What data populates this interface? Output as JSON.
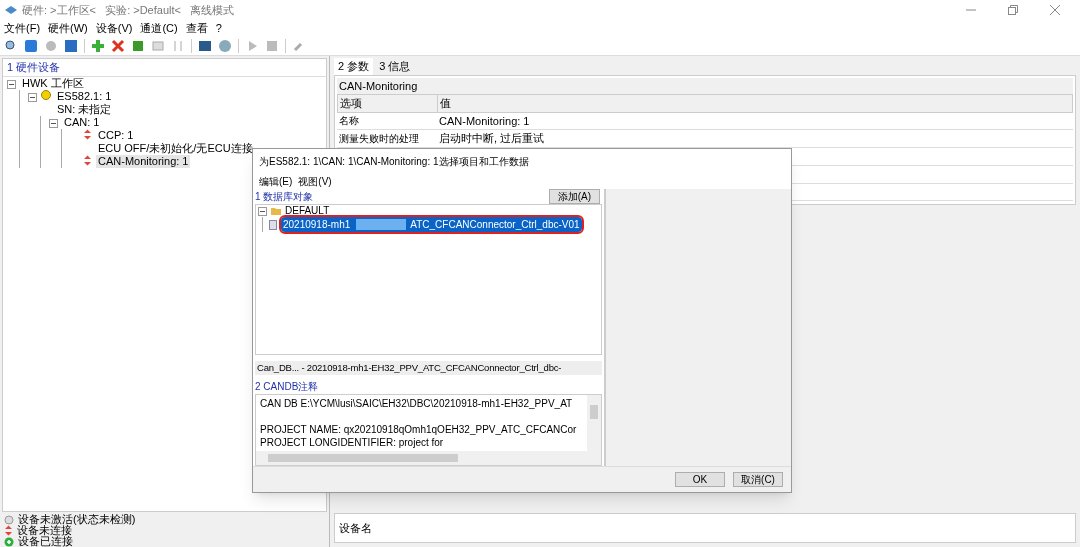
{
  "window": {
    "title": "硬件: >工作区<   实验: >Default<   离线模式"
  },
  "menu": [
    "文件(F)",
    "硬件(W)",
    "设备(V)",
    "通道(C)",
    "查看",
    "?"
  ],
  "hardware_panel": {
    "title": "1 硬件设备",
    "tree": [
      {
        "label": "HWK 工作区",
        "selected": false,
        "children": [
          {
            "label": "ES582.1: 1",
            "sublabel": "SN: 未指定",
            "kind": "unknown",
            "selected": false,
            "children": [
              {
                "label": "CAN: 1",
                "selected": false,
                "children": [
                  {
                    "label": "CCP: 1",
                    "sublabel": "ECU OFF/未初始化/无ECU连接",
                    "kind": "disconnected",
                    "selected": false
                  },
                  {
                    "label": "CAN-Monitoring: 1",
                    "kind": "disconnected",
                    "selected": true
                  }
                ]
              }
            ]
          }
        ]
      }
    ]
  },
  "legend": [
    {
      "label": "设备未激活(状态未检测)",
      "kind": "inactive"
    },
    {
      "label": "设备未连接",
      "kind": "disconnected"
    },
    {
      "label": "设备已连接",
      "kind": "connected"
    }
  ],
  "tabs": [
    {
      "label": "2 参数",
      "selected": true
    },
    {
      "label": "3 信息",
      "selected": false
    }
  ],
  "params": {
    "title": "CAN-Monitoring",
    "columns": [
      "选项",
      "值"
    ],
    "rows": [
      [
        "名称",
        "CAN-Monitoring: 1"
      ],
      [
        "测量失败时的处理",
        "启动时中断, 过后重试"
      ]
    ]
  },
  "device_name_label": "设备名",
  "dialog": {
    "title": "为ES582.1: 1\\CAN: 1\\CAN-Monitoring: 1选择项目和工作数据",
    "menu": [
      "编辑(E)",
      "视图(V)"
    ],
    "db_title": "1 数据库对象",
    "add_button": "添加(A)",
    "db_tree": {
      "label": "DEFAULT",
      "items": [
        {
          "label_start": "20210918-mh1",
          "label_end": "ATC_CFCANConnector_Ctrl_dbc-V01",
          "selected": true
        }
      ]
    },
    "status_line": "Can_DB... - 20210918-mh1-EH32_PPV_ATC_CFCANConnector_Ctrl_dbc-",
    "comment_title": "2 CANDB注释",
    "comment_paragraphs": [
      [
        "CAN DB E:\\YCM\\lusi\\SAIC\\EH32\\DBC\\20210918-mh1-EH32_PPV_AT"
      ],
      [
        "PROJECT NAME: qx20210918qOmh1qOEH32_PPV_ATC_CFCANCor",
        "PROJECT LONGIDENTIFIER: project for"
      ]
    ],
    "buttons": [
      "OK",
      "取消(C)"
    ]
  }
}
